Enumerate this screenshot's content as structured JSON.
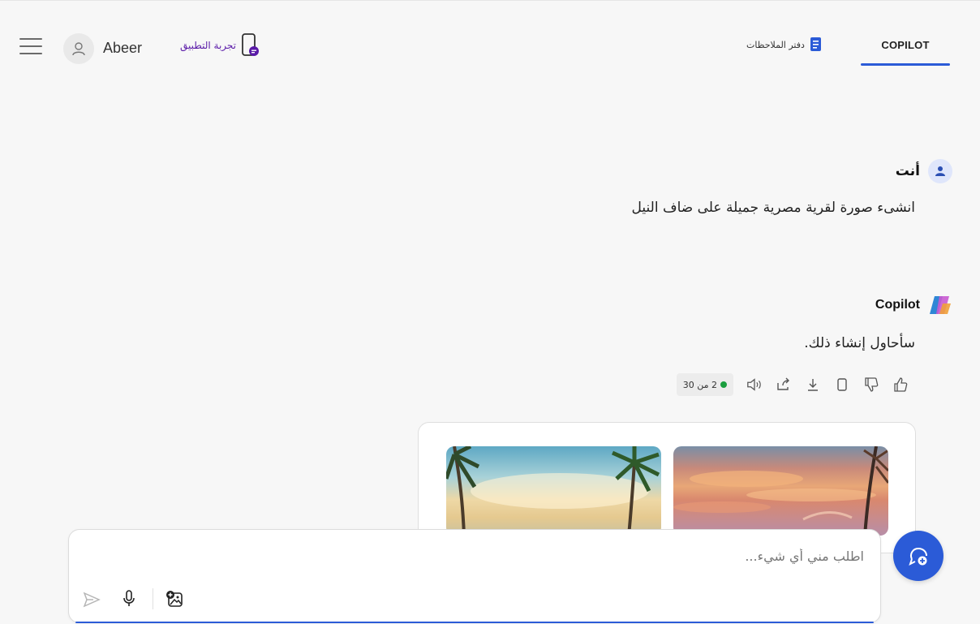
{
  "header": {
    "username": "Abeer",
    "try_app_label": "تجربة التطبيق",
    "tabs": [
      {
        "label": "COPILOT",
        "active": true
      },
      {
        "label": "دفتر الملاحظات",
        "active": false
      }
    ],
    "accent_color": "#2b5bd7"
  },
  "conversation": {
    "user_name": "أنت",
    "user_message": "انشىء صورة لقرية مصرية جميلة على ضاف النيل",
    "bot_name": "Copilot",
    "bot_message": "سأحاول إنشاء ذلك.",
    "counter_label": "2 من 30",
    "status_color": "#1a9e3e"
  },
  "composer": {
    "placeholder": "اطلب مني أي شيء..."
  }
}
